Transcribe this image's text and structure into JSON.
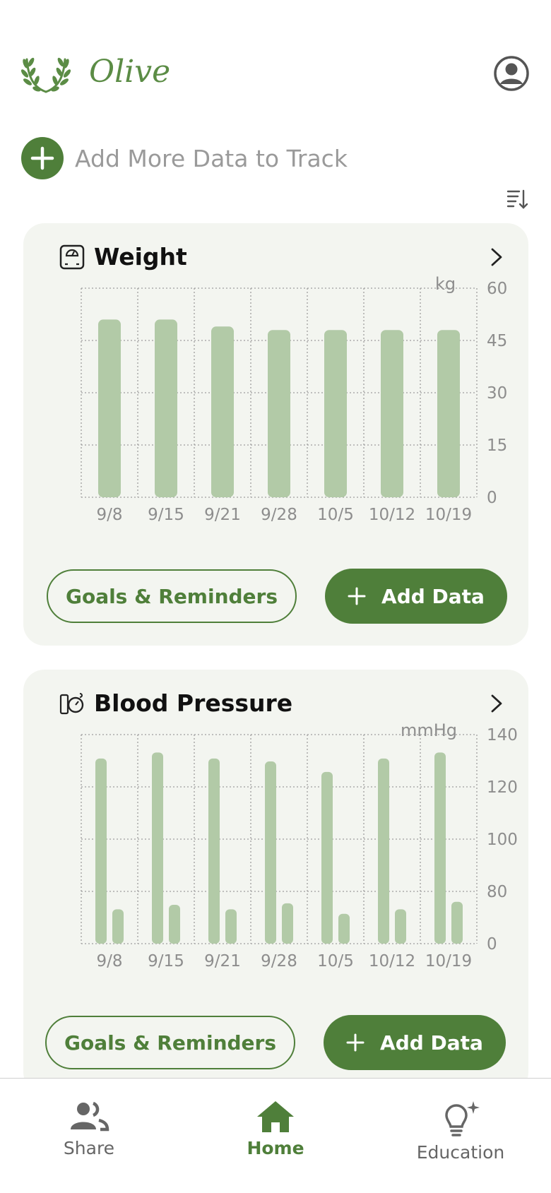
{
  "app": {
    "name": "Olive"
  },
  "add_track": {
    "label": "Add More Data to Track"
  },
  "cards": [
    {
      "title": "Weight",
      "unit": "kg",
      "goals_label": "Goals & Reminders",
      "add_label": "Add Data"
    },
    {
      "title": "Blood Pressure",
      "unit": "mmHg",
      "goals_label": "Goals & Reminders",
      "add_label": "Add Data"
    }
  ],
  "chart_data": [
    {
      "type": "bar",
      "title": "Weight",
      "ylabel": "kg",
      "categories": [
        "9/8",
        "9/15",
        "9/21",
        "9/28",
        "10/5",
        "10/12",
        "10/19"
      ],
      "series": [
        {
          "values": [
            51,
            51,
            49,
            48,
            48,
            48,
            48
          ]
        }
      ],
      "ylim": [
        0,
        60
      ],
      "yticks": [
        0,
        15,
        30,
        45,
        60
      ],
      "grid": true,
      "color": "#b2caa7"
    },
    {
      "type": "bar",
      "title": "Blood Pressure",
      "ylabel": "mmHg",
      "categories": [
        "9/8",
        "9/15",
        "9/21",
        "9/28",
        "10/5",
        "10/12",
        "10/19"
      ],
      "series": [
        {
          "values": [
            124,
            128,
            124,
            122,
            115,
            124,
            128
          ]
        },
        {
          "values": [
            23,
            26,
            23,
            27,
            20,
            23,
            28
          ]
        }
      ],
      "ylim": [
        0,
        140
      ],
      "yticks": [
        0,
        80,
        100,
        120,
        140
      ],
      "grid": true,
      "color": "#b2caa7"
    }
  ],
  "nav": {
    "items": [
      {
        "label": "Share",
        "icon": "people-icon"
      },
      {
        "label": "Home",
        "icon": "home-icon",
        "active": true
      },
      {
        "label": "Education",
        "icon": "lightbulb-icon"
      }
    ]
  },
  "colors": {
    "primary": "#4f7f3a",
    "bar": "#b2caa7",
    "card_bg": "#f3f5f0",
    "logo": "#5b8c45"
  }
}
